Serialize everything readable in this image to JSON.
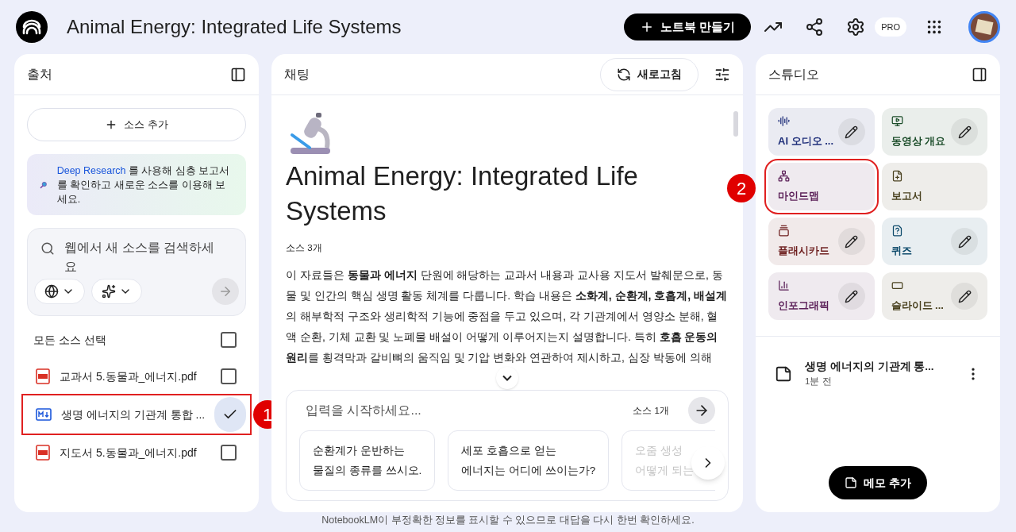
{
  "header": {
    "title": "Animal Energy: Integrated Life Systems",
    "create_button": "노트북 만들기",
    "pro_badge": "PRO"
  },
  "sources_panel": {
    "title": "출처",
    "add_button": "소스 추가",
    "promo_link": "Deep Research",
    "promo_rest": " 를 사용해 심층 보고서를 확인하고 새로운 소스를 이용해 보세요.",
    "search_placeholder": "웹에서 새 소스를 검색하세요",
    "select_all": {
      "label": "모든 소스 선택",
      "checked": false
    },
    "items": [
      {
        "kind": "pdf",
        "name": "교과서 5.동물과_에너지.pdf",
        "checked": false,
        "highlighted": false
      },
      {
        "kind": "markdown",
        "name": "생명 에너지의 기관계 통합 ...",
        "checked": true,
        "highlighted": true,
        "marker": "1"
      },
      {
        "kind": "pdf",
        "name": "지도서 5.동물과_에너지.pdf",
        "checked": false,
        "highlighted": false
      }
    ]
  },
  "chat_panel": {
    "title": "채팅",
    "refresh_button": "새로고침",
    "notebook_title": "Animal Energy: Integrated Life Systems",
    "source_count": "소스 3개",
    "summary": "이 자료들은 **동물과 에너지** 단원에 해당하는 교과서 내용과 교사용 지도서 발췌문으로, 동물 및 인간의 핵심 생명 활동 체계를 다룹니다. 학습 내용은 **소화계, 순환계, 호흡계, 배설계**의 해부학적 구조와 생리학적 기능에 중점을 두고 있으며, 각 기관계에서 영양소 분해, 혈액 순환, 기체 교환 및 노폐물 배설이 어떻게 이루어지는지 설명합니다. 특히 **호흡 운동의 원리**를 횡격막과 갈비뼈의 움직임 및 기압 변화와 연관하여 제시하고, 심장 박동에 의해",
    "input_placeholder": "입력을 시작하세요...",
    "input_source_count": "소스 1개",
    "suggestions": [
      {
        "lines": [
          "순환계가 운반하는",
          "물질의 종류를 쓰시오."
        ],
        "faded": false
      },
      {
        "lines": [
          "세포 호흡으로 얻는",
          "에너지는 어디에 쓰이는가?"
        ],
        "faded": false
      },
      {
        "lines": [
          "오줌 생성",
          "어떻게 되는"
        ],
        "faded": true
      }
    ]
  },
  "studio_panel": {
    "title": "스튜디오",
    "tiles": [
      {
        "kind": "audio",
        "label": "AI 오디오 ...",
        "color": "#1f2f7a",
        "editable": true,
        "highlighted": false
      },
      {
        "kind": "video",
        "label": "동영상 개요",
        "color": "#1c4d2a",
        "editable": true,
        "highlighted": false
      },
      {
        "kind": "mindmap",
        "label": "마인드맵",
        "color": "#5a1e57",
        "editable": false,
        "highlighted": true,
        "marker": "2"
      },
      {
        "kind": "report",
        "label": "보고서",
        "color": "#4a4220",
        "editable": false,
        "highlighted": false
      },
      {
        "kind": "flashcards",
        "label": "플래시카드",
        "color": "#6e1f1f",
        "editable": true,
        "highlighted": false
      },
      {
        "kind": "quiz",
        "label": "퀴즈",
        "color": "#0d4a6b",
        "editable": true,
        "highlighted": false
      },
      {
        "kind": "infographic",
        "label": "인포그래픽",
        "color": "#5a1e57",
        "editable": true,
        "highlighted": false
      },
      {
        "kind": "slides",
        "label": "슬라이드 ...",
        "color": "#4a4220",
        "editable": true,
        "highlighted": false
      }
    ],
    "note": {
      "title": "생명 에너지의 기관계 통...",
      "time": "1분 전"
    },
    "add_note_button": "메모 추가"
  },
  "footer": "NotebookLM이 부정확한 정보를 표시할 수 있으므로 대답을 다시 한번 확인하세요."
}
